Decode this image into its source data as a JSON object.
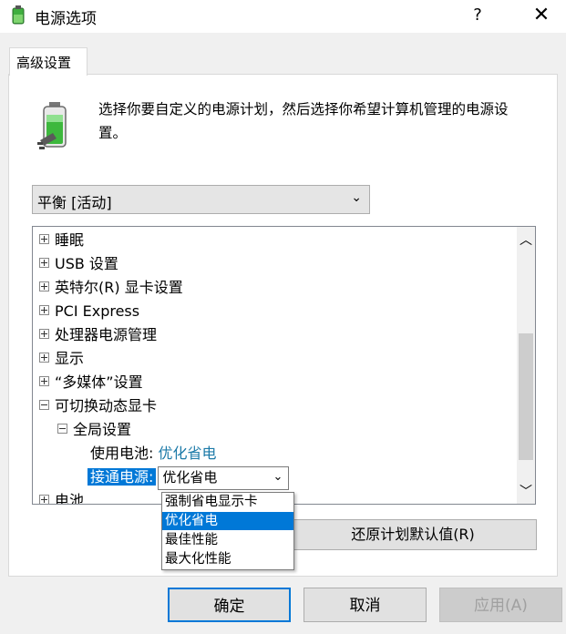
{
  "window": {
    "title": "电源选项",
    "help_label": "?",
    "close_label": "✕",
    "icon": "power-options-icon"
  },
  "tab": {
    "label": "高级设置"
  },
  "description": "选择你要自定义的电源计划，然后选择你希望计算机管理的电源设置。",
  "plan_select": {
    "value": "平衡 [活动]",
    "chevron": "⌄"
  },
  "tree": {
    "items": [
      {
        "label": "睡眠",
        "expander": "plus"
      },
      {
        "label": "USB 设置",
        "expander": "plus"
      },
      {
        "label": "英特尔(R) 显卡设置",
        "expander": "plus"
      },
      {
        "label": "PCI Express",
        "expander": "plus"
      },
      {
        "label": "处理器电源管理",
        "expander": "plus"
      },
      {
        "label": "显示",
        "expander": "plus"
      },
      {
        "label": "“多媒体”设置",
        "expander": "plus"
      },
      {
        "label": "可切换动态显卡",
        "expander": "minus"
      },
      {
        "label": "全局设置",
        "expander": "minus"
      },
      {
        "label": "使用电池:",
        "value": "优化省电"
      },
      {
        "label": "接通电源:",
        "value": "优化省电"
      },
      {
        "label": "电池",
        "expander": "plus"
      }
    ]
  },
  "scrollbar": {
    "up": "︿",
    "down": "﹀"
  },
  "restore_button": "还原计划默认值(R)",
  "dropdown": {
    "options": [
      "强制省电显示卡",
      "优化省电",
      "最佳性能",
      "最大化性能"
    ],
    "selected": "优化省电"
  },
  "buttons": {
    "ok": "确定",
    "cancel": "取消",
    "apply": "应用(A)"
  },
  "colors": {
    "accent": "#0078d7",
    "link": "#1c7aa8"
  }
}
